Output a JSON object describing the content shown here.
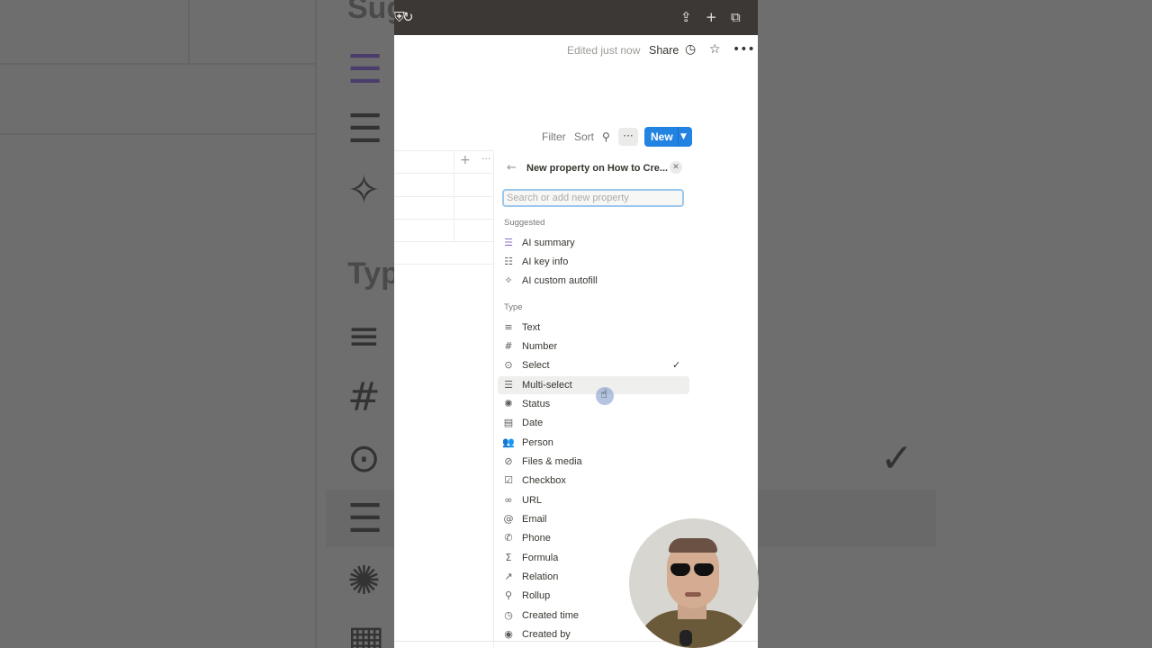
{
  "window": {
    "edited_status": "Edited just now",
    "share_label": "Share"
  },
  "toolbar": {
    "filter": "Filter",
    "sort": "Sort",
    "more": "···",
    "new_label": "New"
  },
  "table": {
    "add": "+",
    "more": "···"
  },
  "menu": {
    "title": "New property on How to Cre...",
    "search_placeholder": "Search or add new property",
    "suggested_heading": "Suggested",
    "suggested": [
      {
        "label": "AI summary",
        "icon": "ai-summary-icon"
      },
      {
        "label": "AI key info",
        "icon": "ai-key-info-icon"
      },
      {
        "label": "AI custom autofill",
        "icon": "ai-autofill-icon"
      }
    ],
    "type_heading": "Type",
    "types": [
      {
        "label": "Text",
        "icon": "text-icon"
      },
      {
        "label": "Number",
        "icon": "number-icon"
      },
      {
        "label": "Select",
        "icon": "select-icon",
        "checked": true
      },
      {
        "label": "Multi-select",
        "icon": "multi-select-icon",
        "hovered": true
      },
      {
        "label": "Status",
        "icon": "status-icon"
      },
      {
        "label": "Date",
        "icon": "date-icon"
      },
      {
        "label": "Person",
        "icon": "person-icon"
      },
      {
        "label": "Files & media",
        "icon": "paperclip-icon"
      },
      {
        "label": "Checkbox",
        "icon": "checkbox-icon"
      },
      {
        "label": "URL",
        "icon": "link-icon"
      },
      {
        "label": "Email",
        "icon": "at-icon"
      },
      {
        "label": "Phone",
        "icon": "phone-icon"
      },
      {
        "label": "Formula",
        "icon": "sigma-icon"
      },
      {
        "label": "Relation",
        "icon": "arrow-up-right-icon"
      },
      {
        "label": "Rollup",
        "icon": "search-icon"
      },
      {
        "label": "Created time",
        "icon": "clock-icon"
      },
      {
        "label": "Created by",
        "icon": "user-circle-icon"
      }
    ]
  },
  "background_text": {
    "top": "Sug",
    "type": "Typ"
  },
  "colors": {
    "accent": "#2383e2",
    "topbar": "#3b3836",
    "focus_ring": "#9cc8ee"
  }
}
